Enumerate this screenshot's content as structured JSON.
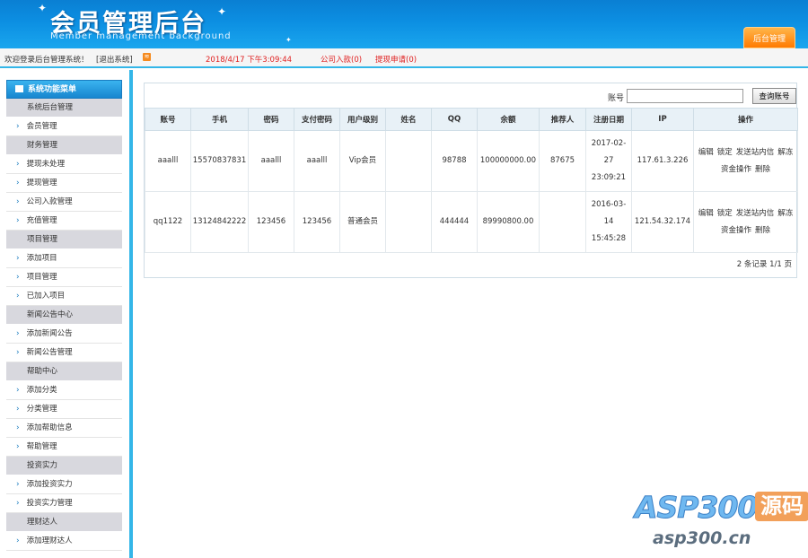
{
  "header": {
    "title": "会员管理后台",
    "subtitle": "Member management background",
    "tab_label": "后台管理"
  },
  "status": {
    "welcome": "欢迎登录后台管理系统！",
    "logout": "[退出系统]",
    "datetime": "2018/4/17 下午3:09:44",
    "company_in": "公司入款(0)",
    "withdraw_req": "提现申请(0)"
  },
  "sidebar": {
    "title": "系统功能菜单",
    "items": [
      {
        "type": "sec",
        "label": "系统后台管理"
      },
      {
        "type": "item",
        "label": "会员管理"
      },
      {
        "type": "sec",
        "label": "财务管理"
      },
      {
        "type": "item",
        "label": "提现未处理"
      },
      {
        "type": "item",
        "label": "提现管理"
      },
      {
        "type": "item",
        "label": "公司入款管理"
      },
      {
        "type": "item",
        "label": "充值管理"
      },
      {
        "type": "sec",
        "label": "项目管理"
      },
      {
        "type": "item",
        "label": "添加项目"
      },
      {
        "type": "item",
        "label": "项目管理"
      },
      {
        "type": "item",
        "label": "已加入项目"
      },
      {
        "type": "sec",
        "label": "新闻公告中心"
      },
      {
        "type": "item",
        "label": "添加新闻公告"
      },
      {
        "type": "item",
        "label": "新闻公告管理"
      },
      {
        "type": "sec",
        "label": "帮助中心"
      },
      {
        "type": "item",
        "label": "添加分类"
      },
      {
        "type": "item",
        "label": "分类管理"
      },
      {
        "type": "item",
        "label": "添加帮助信息"
      },
      {
        "type": "item",
        "label": "帮助管理"
      },
      {
        "type": "sec",
        "label": "投资实力"
      },
      {
        "type": "item",
        "label": "添加投资实力"
      },
      {
        "type": "item",
        "label": "投资实力管理"
      },
      {
        "type": "sec",
        "label": "理财达人"
      },
      {
        "type": "item",
        "label": "添加理财达人"
      }
    ]
  },
  "search": {
    "label": "账号",
    "placeholder": "",
    "button": "查询账号"
  },
  "table": {
    "columns": [
      "账号",
      "手机",
      "密码",
      "支付密码",
      "用户级别",
      "姓名",
      "QQ",
      "余额",
      "推荐人",
      "注册日期",
      "IP",
      "操作"
    ],
    "rows": [
      {
        "account": "aaalll",
        "phone": "15570837831",
        "password": "aaalll",
        "pay_password": "aaalll",
        "level": "Vip会员",
        "name": "",
        "qq": "98788",
        "balance": "100000000.00",
        "referrer": "87675",
        "date_l1": "2017-02-",
        "date_l2": "27",
        "date_l3": "23:09:21",
        "ip": "117.61.3.226"
      },
      {
        "account": "qq1122",
        "phone": "13124842222",
        "password": "123456",
        "pay_password": "123456",
        "level": "普通会员",
        "name": "",
        "qq": "444444",
        "balance": "89990800.00",
        "referrer": "",
        "date_l1": "2016-03-",
        "date_l2": "14",
        "date_l3": "15:45:28",
        "ip": "121.54.32.174"
      }
    ],
    "ops": {
      "edit": "编辑",
      "lock": "锁定",
      "send_msg": "发送站内信",
      "unfreeze": "解冻",
      "funds": "资金操作",
      "delete": "删除"
    }
  },
  "pager": {
    "text": "2 条记录 1/1 页"
  },
  "watermark": {
    "logo": "ASP300",
    "logo_box": "源码",
    "url": "asp300.cn"
  }
}
